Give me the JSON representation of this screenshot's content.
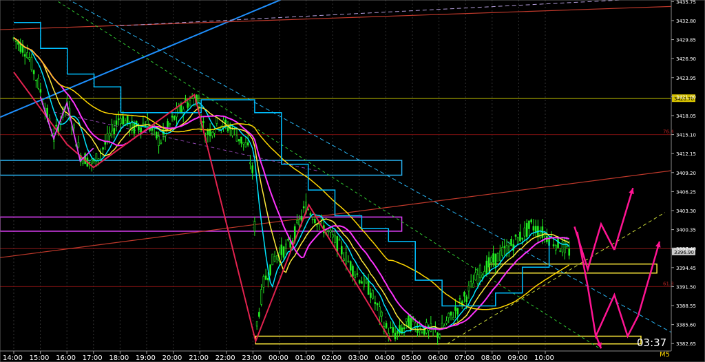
{
  "chart_data": {
    "type": "line",
    "timeframe": "M5",
    "countdown": "03:37",
    "colors": {
      "background": "#000000",
      "candles": "#22ee22",
      "grid": "#333333",
      "ma_fast": "#00e5ff",
      "ma_mid": "#ffd700",
      "ma_magenta": "#ff33ff",
      "ma_slow": "#ffd700",
      "zigzag": "#e3224f",
      "projection": "#ff1493",
      "stairs": "#00bfff",
      "trend_blue": "#1e90ff",
      "trend_red": "#c0392b"
    },
    "y_ticks": [
      "3435.75",
      "3432.80",
      "3429.85",
      "3426.90",
      "3423.95",
      "3421.00",
      "3418.05",
      "3415.10",
      "3412.15",
      "3409.20",
      "3406.25",
      "3403.30",
      "3400.35",
      "3397.40",
      "3394.45",
      "3391.50",
      "3388.55",
      "3385.60",
      "3382.65"
    ],
    "x_ticks": [
      "14:00",
      "15:00",
      "16:00",
      "17:00",
      "18:00",
      "19:00",
      "20:00",
      "21:00",
      "22:00",
      "23:00",
      "00:00",
      "01:00",
      "02:00",
      "03:00",
      "04:00",
      "05:00",
      "06:00",
      "07:00",
      "08:00",
      "09:00",
      "10:00"
    ],
    "ylim": [
      3381.5,
      3436.0
    ],
    "price_labels": {
      "level_line": "3420.70",
      "current": "3396.90"
    },
    "fib_labels": [
      "76.4",
      "61.8"
    ],
    "horizontal_levels": [
      3420.7,
      3415.1,
      3397.4,
      3391.5
    ],
    "zigzag": [
      {
        "x": 0,
        "y": 3424.8
      },
      {
        "x": 2,
        "y": 3413.6
      },
      {
        "x": 3,
        "y": 3410.0
      },
      {
        "x": 6.8,
        "y": 3421.3
      },
      {
        "x": 9.1,
        "y": 3383.0
      },
      {
        "x": 11.1,
        "y": 3404.2
      },
      {
        "x": 14.2,
        "y": 3383.0
      }
    ],
    "projection": [
      {
        "x": 21.1,
        "y": 3400.8
      },
      {
        "x": 21.6,
        "y": 3394.2
      },
      {
        "x": 22.3,
        "y": 3401.4
      },
      {
        "x": 23.1,
        "y": 3396.2
      },
      {
        "x": 24.2,
        "y": 3406.8
      },
      {
        "x": 23.5,
        "y": 3394.4
      }
    ]
  }
}
